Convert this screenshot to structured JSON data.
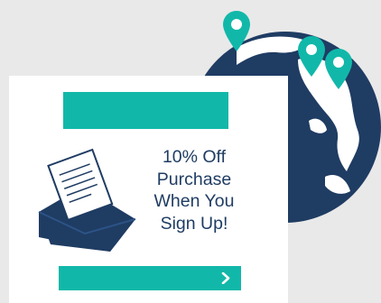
{
  "offer": {
    "line1": "10% Off",
    "line2": "Purchase",
    "line3": "When You",
    "line4": "Sign Up!"
  },
  "icons": {
    "globe": "globe-icon",
    "pins": "map-pin-icon",
    "envelope": "envelope-icon",
    "chevron": "chevron-right-icon"
  },
  "colors": {
    "accent": "#11b8a9",
    "navy": "#1f3c63",
    "background": "#e9e9e9",
    "card": "#ffffff"
  }
}
